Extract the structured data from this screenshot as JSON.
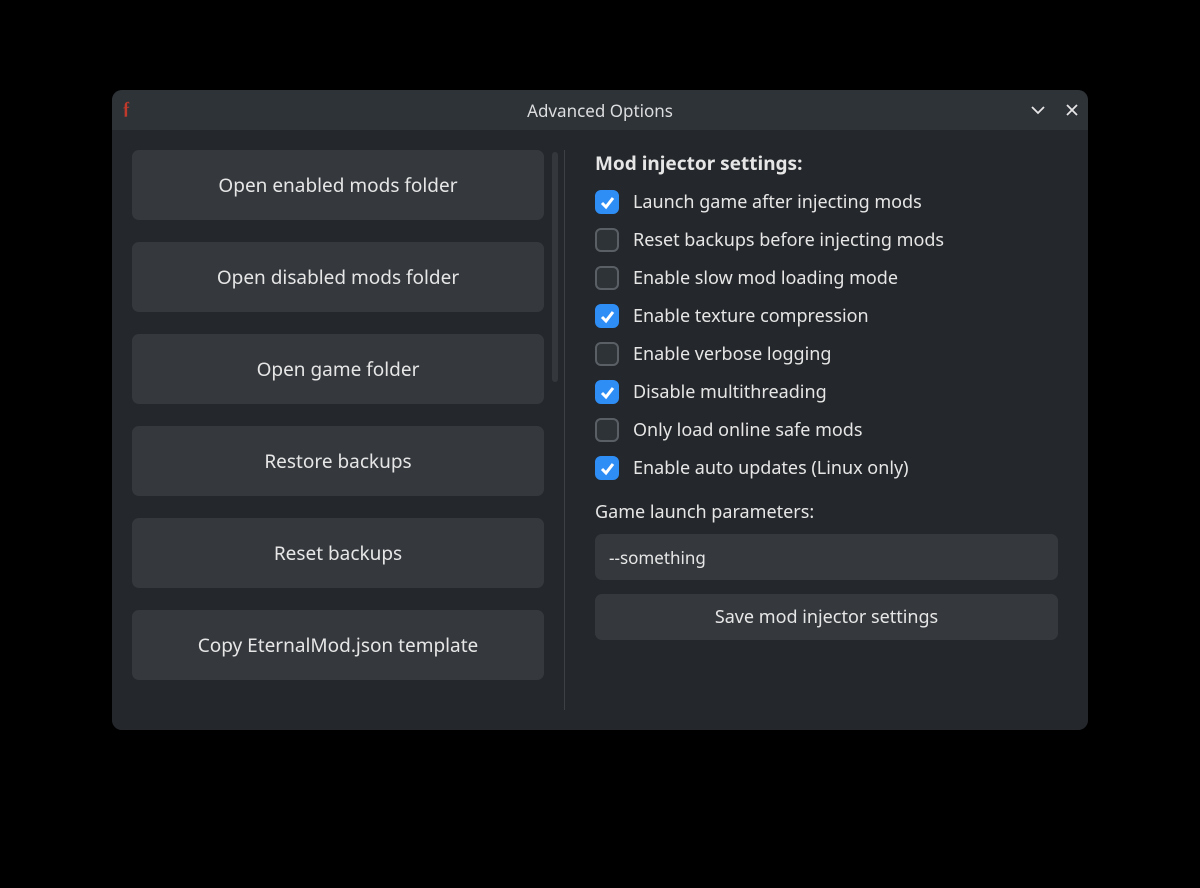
{
  "window": {
    "title": "Advanced Options",
    "app_icon_glyph": "ƒ"
  },
  "left_buttons": [
    {
      "id": "open-enabled-mods-folder",
      "label": "Open enabled mods folder"
    },
    {
      "id": "open-disabled-mods-folder",
      "label": "Open disabled mods folder"
    },
    {
      "id": "open-game-folder",
      "label": "Open game folder"
    },
    {
      "id": "restore-backups",
      "label": "Restore backups"
    },
    {
      "id": "reset-backups",
      "label": "Reset backups"
    },
    {
      "id": "copy-eternalmod-template",
      "label": "Copy EternalMod.json template"
    }
  ],
  "settings": {
    "heading": "Mod injector settings:",
    "items": [
      {
        "id": "launch-after-inject",
        "label": "Launch game after injecting mods",
        "checked": true
      },
      {
        "id": "reset-before-inject",
        "label": "Reset backups before injecting mods",
        "checked": false
      },
      {
        "id": "slow-mod-loading",
        "label": "Enable slow mod loading mode",
        "checked": false
      },
      {
        "id": "texture-compression",
        "label": "Enable texture compression",
        "checked": true
      },
      {
        "id": "verbose-logging",
        "label": "Enable verbose logging",
        "checked": false
      },
      {
        "id": "disable-multithread",
        "label": "Disable multithreading",
        "checked": true
      },
      {
        "id": "online-safe-only",
        "label": "Only load online safe mods",
        "checked": false
      },
      {
        "id": "auto-updates-linux",
        "label": "Enable auto updates (Linux only)",
        "checked": true
      }
    ],
    "launch_params_label": "Game launch parameters:",
    "launch_params_value": "--something",
    "save_label": "Save mod injector settings"
  }
}
